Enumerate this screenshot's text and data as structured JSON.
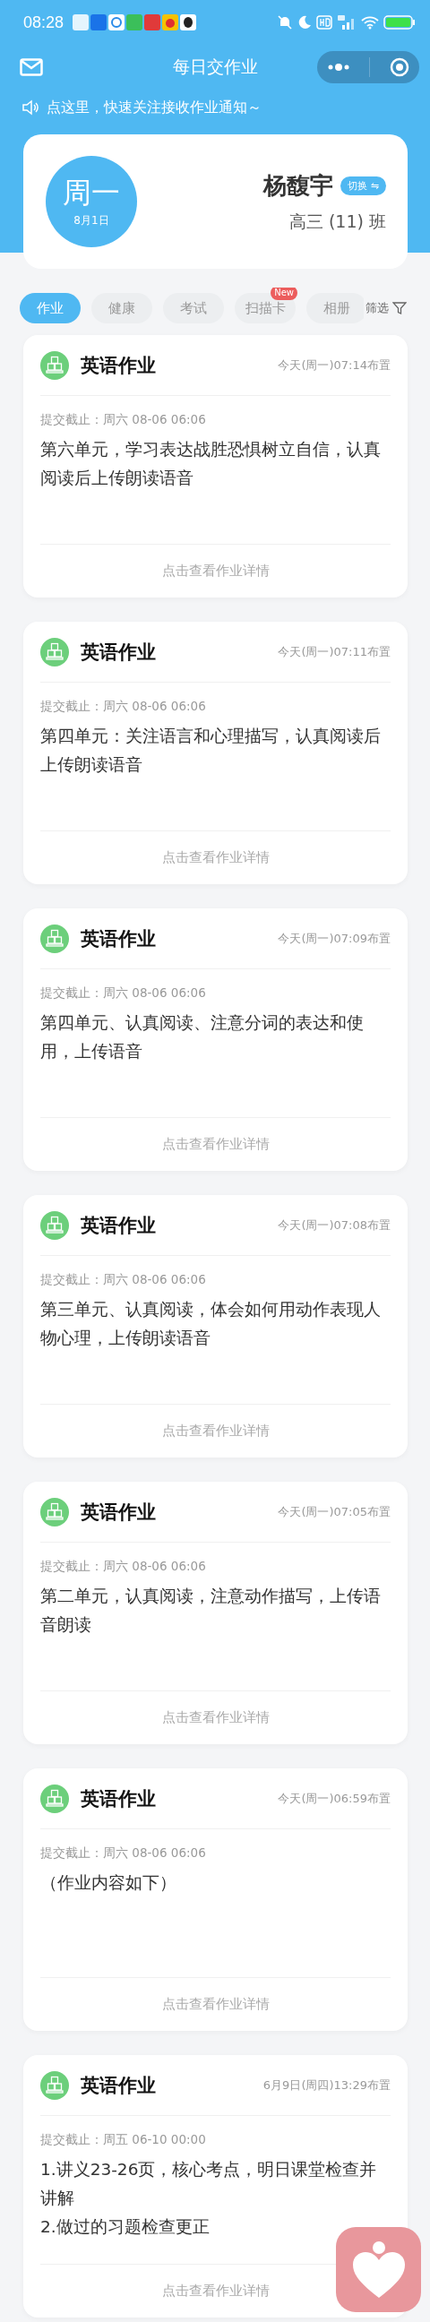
{
  "status_bar": {
    "time": "08:28"
  },
  "nav": {
    "title": "每日交作业"
  },
  "notice": {
    "text": "点这里，快速关注接收作业通知～"
  },
  "profile": {
    "weekday": "周一",
    "date": "8月1日",
    "name": "杨馥宇",
    "switch_label": "切换 ⇋",
    "class_name": "高三 (11) 班"
  },
  "tabs": [
    {
      "label": "作业",
      "selected": true
    },
    {
      "label": "健康",
      "selected": false
    },
    {
      "label": "考试",
      "selected": false
    },
    {
      "label": "扫描卡",
      "selected": false,
      "badge": "New"
    },
    {
      "label": "相册",
      "selected": false
    }
  ],
  "filter": {
    "label": "筛选"
  },
  "assignments": [
    {
      "subject": "英语作业",
      "assigned": "今天(周一)07:14布置",
      "deadline": "提交截止：周六 08-06 06:06",
      "content": "第六单元，学习表达战胜恐惧树立自信，认真阅读后上传朗读语音",
      "action": "点击查看作业详情"
    },
    {
      "subject": "英语作业",
      "assigned": "今天(周一)07:11布置",
      "deadline": "提交截止：周六 08-06 06:06",
      "content": "第四单元：关注语言和心理描写，认真阅读后上传朗读语音",
      "action": "点击查看作业详情"
    },
    {
      "subject": "英语作业",
      "assigned": "今天(周一)07:09布置",
      "deadline": "提交截止：周六 08-06 06:06",
      "content": "第四单元、认真阅读、注意分词的表达和使用，上传语音",
      "action": "点击查看作业详情"
    },
    {
      "subject": "英语作业",
      "assigned": "今天(周一)07:08布置",
      "deadline": "提交截止：周六 08-06 06:06",
      "content": "第三单元、认真阅读，体会如何用动作表现人物心理，上传朗读语音",
      "action": "点击查看作业详情"
    },
    {
      "subject": "英语作业",
      "assigned": "今天(周一)07:05布置",
      "deadline": "提交截止：周六 08-06 06:06",
      "content": "第二单元，认真阅读，注意动作描写，上传语音朗读",
      "action": "点击查看作业详情"
    },
    {
      "subject": "英语作业",
      "assigned": "今天(周一)06:59布置",
      "deadline": "提交截止：周六 08-06 06:06",
      "content": "（作业内容如下）",
      "action": "点击查看作业详情"
    },
    {
      "subject": "英语作业",
      "assigned": "6月9日(周四)13:29布置",
      "deadline": "提交截止：周五 06-10 00:00",
      "content": "1.讲义23-26页，核心考点，明日课堂检查并讲解\n2.做过的习题检查更正",
      "action": "点击查看作业详情"
    }
  ]
}
